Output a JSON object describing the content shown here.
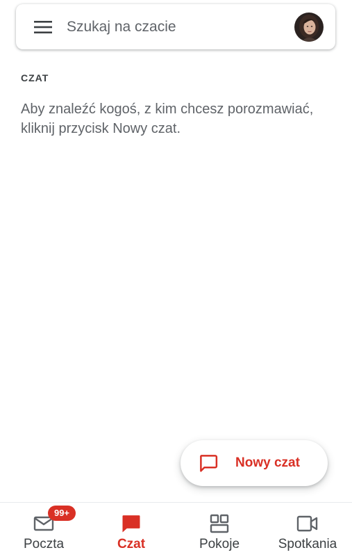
{
  "colors": {
    "accent": "#d93025",
    "icon_gray": "#5f6368",
    "text_gray": "#5f6368",
    "label_dark": "#3c4043"
  },
  "search": {
    "placeholder": "Szukaj na czacie",
    "menu_icon": "menu-icon",
    "avatar": "user-avatar"
  },
  "main": {
    "section_heading": "CZAT",
    "empty_message": "Aby znaleźć kogoś, z kim chcesz porozmawiać, kliknij przycisk Nowy czat."
  },
  "fab": {
    "icon": "new-chat-icon",
    "label": "Nowy czat"
  },
  "bottom_nav": {
    "items": [
      {
        "label": "Poczta",
        "icon": "mail-icon",
        "badge": "99+",
        "active": false
      },
      {
        "label": "Czat",
        "icon": "chat-icon",
        "active": true
      },
      {
        "label": "Pokoje",
        "icon": "rooms-icon",
        "active": false
      },
      {
        "label": "Spotkania",
        "icon": "meet-icon",
        "active": false
      }
    ]
  }
}
